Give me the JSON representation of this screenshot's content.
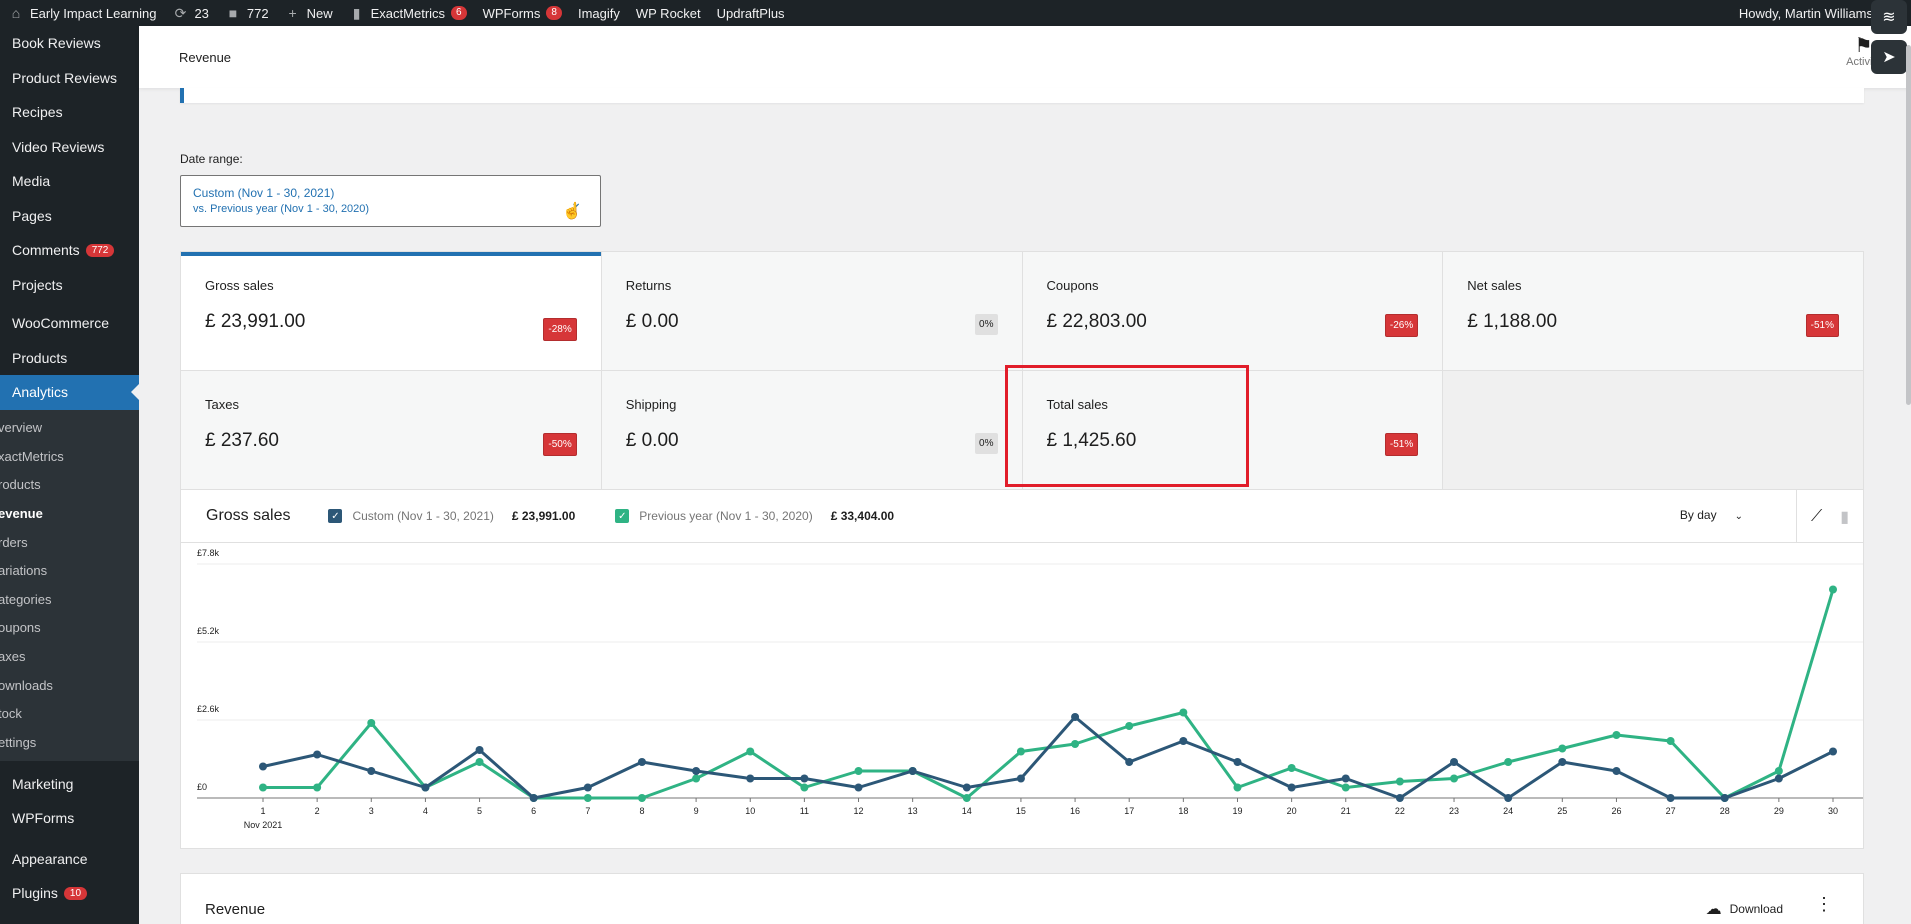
{
  "adminbar": {
    "site_name": "Early Impact Learning",
    "updates_count": "23",
    "comments_count": "772",
    "new_label": "New",
    "exactmetrics_label": "ExactMetrics",
    "exactmetrics_badge": "6",
    "wpforms_label": "WPForms",
    "wpforms_badge": "8",
    "imagify_label": "Imagify",
    "wprocket_label": "WP Rocket",
    "updraft_label": "UpdraftPlus",
    "greeting": "Howdy, Martin Williams"
  },
  "sidebar": {
    "items_top": [
      {
        "label": "Book Reviews"
      },
      {
        "label": "Product Reviews"
      },
      {
        "label": "Recipes"
      },
      {
        "label": "Video Reviews"
      },
      {
        "label": "Media"
      },
      {
        "label": "Pages"
      },
      {
        "label": "Comments",
        "badge": "772"
      },
      {
        "label": "Projects"
      },
      {
        "label": "WooCommerce"
      },
      {
        "label": "Products"
      },
      {
        "label": "Analytics"
      }
    ],
    "submenu": [
      "verview",
      "xactMetrics",
      "roducts",
      "evenue",
      "rders",
      "ariations",
      "ategories",
      "oupons",
      "axes",
      "ownloads",
      "tock",
      "ettings"
    ],
    "items_bottom": [
      {
        "label": "Marketing"
      },
      {
        "label": "WPForms"
      },
      {
        "label": "Appearance"
      },
      {
        "label": "Plugins",
        "badge": "10"
      }
    ]
  },
  "header": {
    "title": "Revenue",
    "activity_label": "Activity"
  },
  "date_range": {
    "label": "Date range:",
    "primary": "Custom (Nov 1 - 30, 2021)",
    "secondary": "vs. Previous year (Nov 1 - 30, 2020)"
  },
  "summary": [
    {
      "label": "Gross sales",
      "value": "£ 23,991.00",
      "delta": "-28%"
    },
    {
      "label": "Returns",
      "value": "£ 0.00",
      "delta": "0%"
    },
    {
      "label": "Coupons",
      "value": "£ 22,803.00",
      "delta": "-26%"
    },
    {
      "label": "Net sales",
      "value": "£ 1,188.00",
      "delta": "-51%"
    },
    {
      "label": "Taxes",
      "value": "£ 237.60",
      "delta": "-50%"
    },
    {
      "label": "Shipping",
      "value": "£ 0.00",
      "delta": "0%"
    },
    {
      "label": "Total sales",
      "value": "£ 1,425.60",
      "delta": "-51%"
    }
  ],
  "chart_panel": {
    "title": "Gross sales",
    "legend_current": "Custom (Nov 1 - 30, 2021)",
    "total_current": "£ 23,991.00",
    "legend_previous": "Previous year (Nov 1 - 30, 2020)",
    "total_previous": "£ 33,404.00",
    "interval": "By day"
  },
  "chart_data": {
    "type": "line",
    "x": [
      1,
      2,
      3,
      4,
      5,
      6,
      7,
      8,
      9,
      10,
      11,
      12,
      13,
      14,
      15,
      16,
      17,
      18,
      19,
      20,
      21,
      22,
      23,
      24,
      25,
      26,
      27,
      28,
      29,
      30
    ],
    "x_first_sublabel": "Nov 2021",
    "y_ticks": [
      "£0",
      "£2.6k",
      "£5.2k",
      "£7.8k"
    ],
    "ylim": [
      0,
      7800
    ],
    "grid": true,
    "series": [
      {
        "name": "Custom (Nov 1 - 30, 2021)",
        "color": "#2c5777",
        "values": [
          1050,
          1450,
          900,
          350,
          1600,
          0,
          350,
          1200,
          900,
          650,
          650,
          350,
          900,
          350,
          650,
          2700,
          1200,
          1900,
          1200,
          350,
          650,
          0,
          1200,
          0,
          1200,
          900,
          0,
          0,
          650,
          1550
        ]
      },
      {
        "name": "Previous year (Nov 1 - 30, 2020)",
        "color": "#2fb384",
        "values": [
          350,
          350,
          2500,
          350,
          1200,
          0,
          0,
          0,
          650,
          1550,
          350,
          900,
          900,
          0,
          1550,
          1800,
          2400,
          2850,
          350,
          1000,
          350,
          550,
          650,
          1200,
          1650,
          2100,
          1900,
          0,
          900,
          6950
        ]
      }
    ]
  },
  "table_panel": {
    "title": "Revenue",
    "download_label": "Download"
  },
  "colors": {
    "accent": "#2271b1",
    "negative": "#d63638",
    "highlight": "#e11d2a"
  }
}
